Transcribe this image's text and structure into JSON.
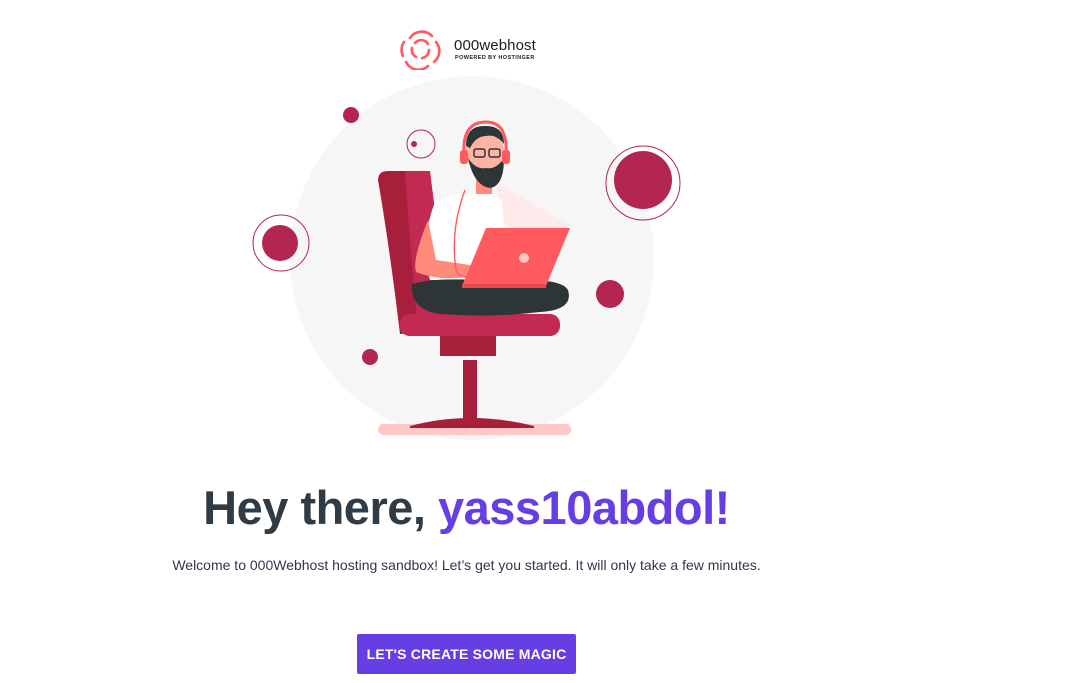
{
  "brand": {
    "name": "000webhost",
    "tagline": "POWERED BY HOSTINGER",
    "colors": {
      "primary": "#673de6",
      "logo_red": "#ff5a5f",
      "accent_crimson": "#b32650"
    }
  },
  "illustration": {
    "icon": "person-on-chair-with-laptop-illustration"
  },
  "greeting": {
    "prefix": "Hey there, ",
    "username": "yass10abdol",
    "suffix": "!"
  },
  "welcome_text": "Welcome to 000Webhost hosting sandbox! Let’s get you started. It will only take a few minutes.",
  "cta": {
    "label": "LET'S CREATE SOME MAGIC"
  }
}
